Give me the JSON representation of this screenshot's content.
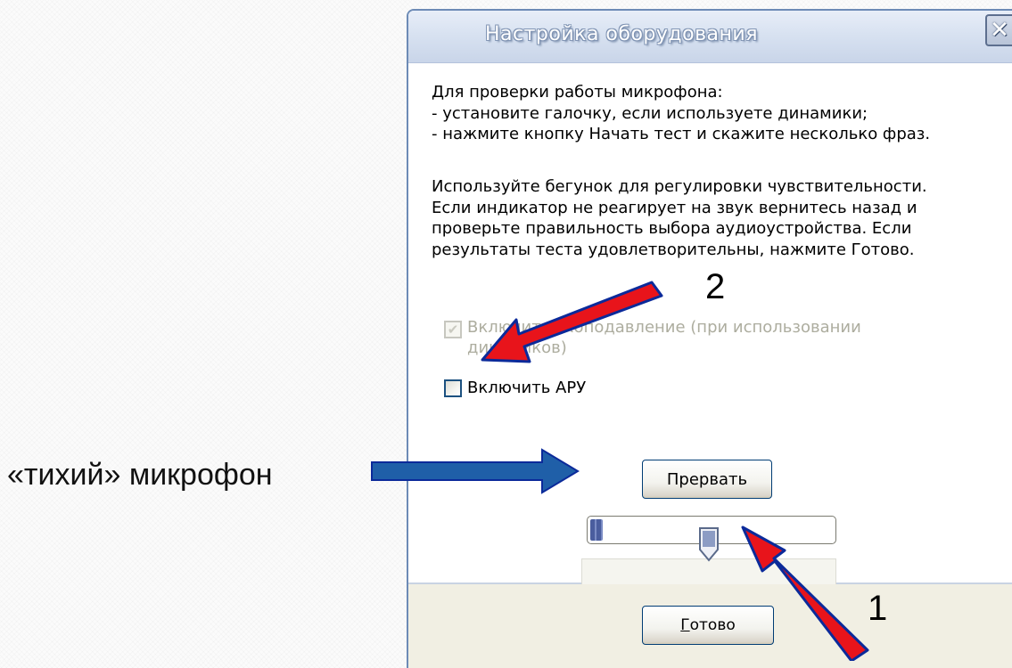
{
  "dialog": {
    "title": "Настройка оборудования",
    "close_glyph": "✕",
    "description_1": [
      "Для проверки работы микрофона:",
      "- установите галочку, если используете динамики;",
      "- нажмите кнопку Начать тест и скажите несколько фраз."
    ],
    "description_2": [
      "Используйте бегунок для регулировки чувствительности.",
      "Если индикатор не реагирует на звук вернитесь назад и",
      "проверьте правильность выбора аудиоустройства. Если",
      "результаты теста удовлетворительны, нажмите Готово."
    ],
    "echo_checkbox": {
      "label_line1": "Включить эхоподавление (при использовании",
      "label_line2": "динамиков)",
      "checked": true,
      "enabled": false
    },
    "agc_checkbox": {
      "label": "Включить АРУ",
      "checked": false
    },
    "stop_button": "Прервать",
    "level_meter": {
      "level": 0.05
    },
    "sensitivity_slider": {
      "value": 0.5,
      "tick_count": 11
    },
    "done_button": {
      "accel": "Г",
      "rest": "отово"
    }
  },
  "annotations": {
    "quiet_mic_label": "«тихий» микрофон",
    "marker_1": "1",
    "marker_2": "2",
    "colors": {
      "red_arrow": "#e8141b",
      "blue_arrow": "#1f5fa8",
      "arrow_outline": "#0b2a9a"
    }
  }
}
